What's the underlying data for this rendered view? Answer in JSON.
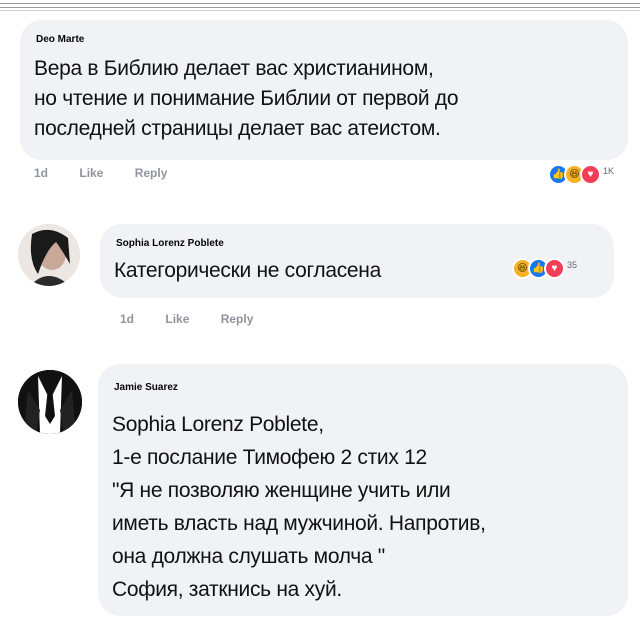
{
  "comments": [
    {
      "author": "Deo Marte",
      "lines": [
        "Вера в Библию делает вас христианином,",
        "но чтение и понимание Библии от первой до",
        "последней страницы делает вас атеистом."
      ],
      "time": "1d",
      "like_label": "Like",
      "reply_label": "Reply",
      "reaction_count": "1K"
    },
    {
      "author": "Sophia Lorenz Poblete",
      "lines": [
        "Категорически не согласена"
      ],
      "time": "1d",
      "like_label": "Like",
      "reply_label": "Reply",
      "reaction_count": "35"
    },
    {
      "author": "Jamie Suarez",
      "lines": [
        "Sophia Lorenz Poblete,",
        "1-е послание Тимофею 2 стих 12",
        "\"Я не позволяю женщине учить или",
        "иметь власть над мужчиной. Напротив,",
        "она должна слушать молча \"",
        "София, заткнись на хуй."
      ]
    }
  ],
  "icons": {
    "like": "thumbs-up-icon",
    "haha": "laughing-face-icon",
    "love": "heart-icon"
  },
  "colors": {
    "bubble": "#f0f2f5",
    "like": "#1877f2",
    "haha": "#f7b125",
    "love": "#f33e58",
    "meta": "#90949c"
  }
}
